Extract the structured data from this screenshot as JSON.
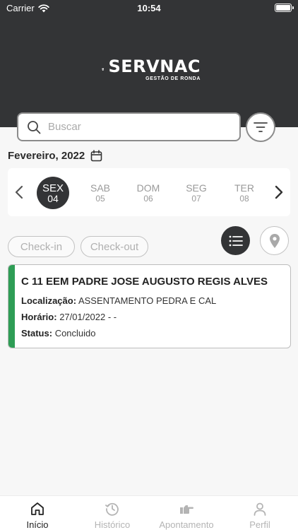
{
  "status_bar": {
    "carrier": "Carrier",
    "time": "10:54"
  },
  "brand": {
    "name": "SERVNAC",
    "tagline": "GESTÃO DE RONDA"
  },
  "search": {
    "placeholder": "Buscar"
  },
  "calendar": {
    "month_label": "Fevereiro, 2022",
    "days": [
      {
        "name": "SEX",
        "date": "04",
        "selected": true
      },
      {
        "name": "SAB",
        "date": "05",
        "selected": false
      },
      {
        "name": "DOM",
        "date": "06",
        "selected": false
      },
      {
        "name": "SEG",
        "date": "07",
        "selected": false
      },
      {
        "name": "TER",
        "date": "08",
        "selected": false
      }
    ]
  },
  "filters": {
    "checkin_label": "Check-in",
    "checkout_label": "Check-out"
  },
  "records": [
    {
      "title": "C 11 EEM PADRE JOSE AUGUSTO REGIS ALVES",
      "location_label": "Localização:",
      "location": "ASSENTAMENTO PEDRA E CAL",
      "time_label": "Horário:",
      "time": "27/01/2022 -  -",
      "status_label": "Status:",
      "status": "Concluido",
      "status_color": "#2e9d55"
    }
  ],
  "tabs": [
    {
      "label": "Início",
      "icon": "home-icon",
      "active": true
    },
    {
      "label": "Histórico",
      "icon": "history-icon",
      "active": false
    },
    {
      "label": "Apontamento",
      "icon": "pointing-hand-icon",
      "active": false
    },
    {
      "label": "Perfil",
      "icon": "user-icon",
      "active": false
    }
  ],
  "colors": {
    "header": "#333436",
    "accent_green": "#2e9d55"
  }
}
